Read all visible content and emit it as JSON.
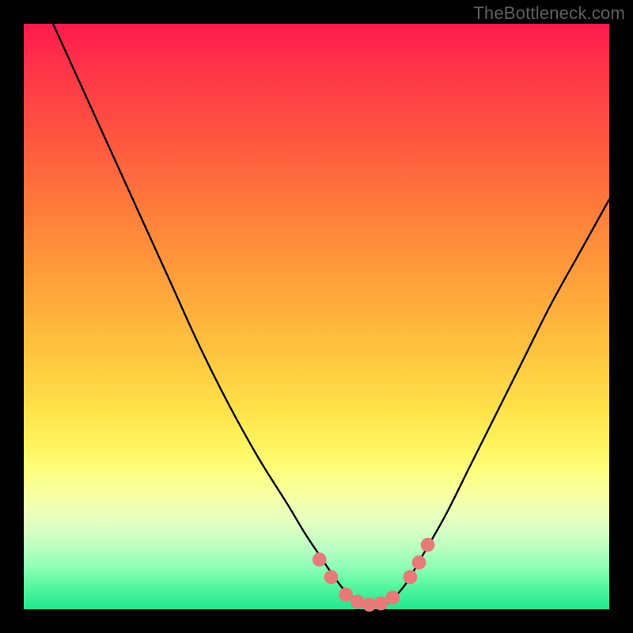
{
  "watermark": "TheBottleneck.com",
  "colors": {
    "curve_stroke": "#000000",
    "marker_fill": "#e97a78",
    "marker_stroke": "#d86763",
    "gradient_top": "#ff1a4d",
    "gradient_bottom": "#1fe88e",
    "page_bg": "#000000"
  },
  "chart_data": {
    "type": "line",
    "title": "",
    "xlabel": "",
    "ylabel": "",
    "xlim": [
      0,
      100
    ],
    "ylim": [
      0,
      100
    ],
    "note": "Axes have no tick labels; values are read as percentages of the plot area. y=0 at bottom (green), y=100 at top (red). Curve is a V-shaped bottleneck profile with minimum (~0) near x≈55–62.",
    "series": [
      {
        "name": "bottleneck-curve",
        "x": [
          5,
          10,
          15,
          20,
          25,
          30,
          35,
          40,
          45,
          48,
          50,
          52,
          55,
          58,
          60,
          62,
          65,
          68,
          72,
          76,
          80,
          85,
          90,
          95,
          100
        ],
        "y": [
          100,
          89,
          78,
          67,
          56,
          45,
          35,
          26,
          18,
          13,
          10,
          7,
          3,
          1,
          0.5,
          1,
          4,
          9,
          16,
          24,
          32,
          42,
          52,
          61,
          70
        ]
      }
    ],
    "markers": {
      "name": "highlight-dots",
      "points": [
        {
          "x": 50.5,
          "y": 8.5
        },
        {
          "x": 52.5,
          "y": 5.5
        },
        {
          "x": 55.0,
          "y": 2.5
        },
        {
          "x": 57.0,
          "y": 1.3
        },
        {
          "x": 59.0,
          "y": 0.8
        },
        {
          "x": 61.0,
          "y": 1.0
        },
        {
          "x": 63.0,
          "y": 2.0
        },
        {
          "x": 66.0,
          "y": 5.5
        },
        {
          "x": 67.5,
          "y": 8.0
        },
        {
          "x": 69.0,
          "y": 11.0
        }
      ],
      "radius_pct": 1.2
    }
  }
}
